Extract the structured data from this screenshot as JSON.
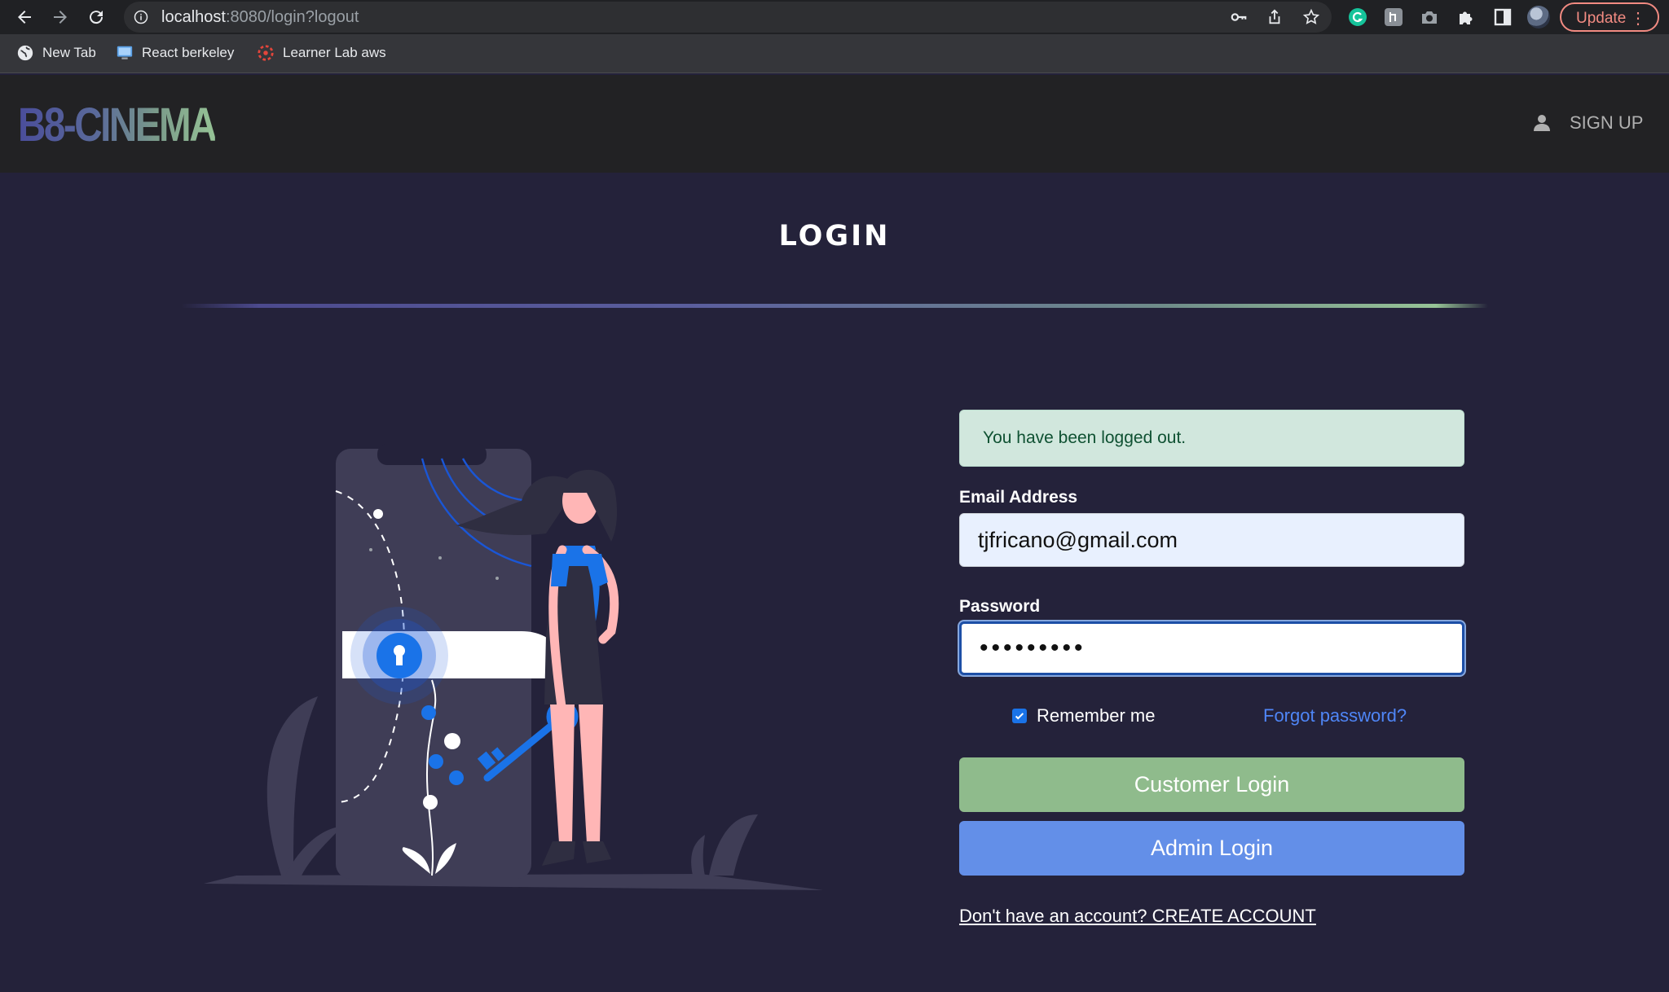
{
  "browser": {
    "url_host": "localhost",
    "url_rest": ":8080/login?logout",
    "update_label": "Update",
    "update_menu": "⋮",
    "bookmarks": [
      {
        "label": "New Tab",
        "icon": "globe-icon"
      },
      {
        "label": "React berkeley",
        "icon": "monitor-icon"
      },
      {
        "label": "Learner Lab aws",
        "icon": "aws-icon"
      }
    ]
  },
  "header": {
    "logo": "B8-CINEMA",
    "signup_label": "SIGN UP"
  },
  "main": {
    "title": "LOGIN",
    "alert": "You have been logged out.",
    "email_label": "Email Address",
    "email_value": "tjfricano@gmail.com",
    "password_label": "Password",
    "password_value": "•••••••••",
    "remember_label": "Remember me",
    "forgot_label": "Forgot password?",
    "customer_login": "Customer Login",
    "admin_login": "Admin Login",
    "create_account": "Don't have an account? CREATE ACCOUNT"
  },
  "colors": {
    "page_bg": "#24223a",
    "header_bg": "#222224",
    "customer_btn": "#8fbb8c",
    "admin_btn": "#638fe8",
    "link": "#4f86f7",
    "alert_bg": "#d1e7dd"
  }
}
